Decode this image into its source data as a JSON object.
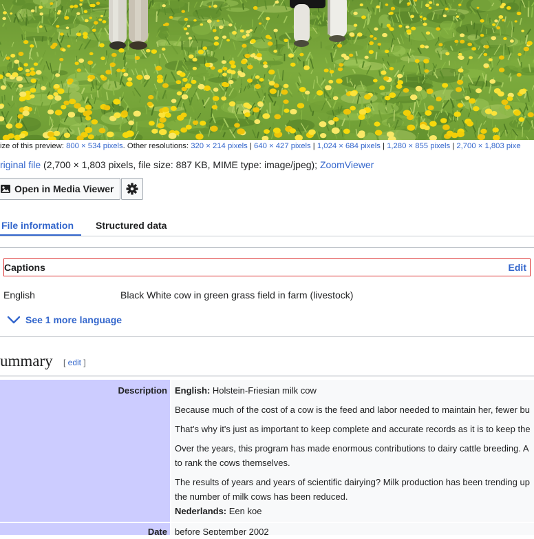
{
  "colors": {
    "link": "#3366cc",
    "text": "#202122",
    "label_bg": "#ccccff",
    "value_bg": "#f8f9fa",
    "caption_border": "#dd3333"
  },
  "resolution_info": {
    "prefix": "ize of this preview: ",
    "preview_size": "800 × 534 pixels",
    "other_label": ". Other resolutions: ",
    "separator": " | ",
    "resolutions": [
      "320 × 214 pixels",
      "640 × 427 pixels",
      "1,024 × 684 pixels",
      "1,280 × 855 pixels",
      "2,700 × 1,803 pixe"
    ]
  },
  "original_file": {
    "link_label": "riginal file",
    "details": " (2,700 × 1,803 pixels, file size: 887 KB, MIME type: image/jpeg); ",
    "zoom_label": "ZoomViewer"
  },
  "toolbar": {
    "media_viewer_label": "Open in Media Viewer",
    "media_viewer_icon": "image-icon",
    "settings_icon": "gear-icon"
  },
  "tabs": [
    {
      "label": "File information",
      "active": true
    },
    {
      "label": "Structured data",
      "active": false
    }
  ],
  "captions": {
    "title": "Captions",
    "edit_label": "Edit",
    "rows": [
      {
        "language": "English",
        "text": "Black White cow in green grass field in farm (livestock)"
      }
    ],
    "more_label": "See 1 more language",
    "more_icon": "chevron-down-icon"
  },
  "summary": {
    "heading": "ummary",
    "edit_open": "[ ",
    "edit_label": "edit",
    "edit_close": " ]",
    "description": {
      "label": "Description",
      "english_lang": "English:",
      "english_text": " Holstein-Friesian milk cow",
      "paragraphs": [
        [
          "Because much of the cost of a cow is the feed and labor needed to maintain her, fewer bu"
        ],
        [
          "That's why it's just as important to keep complete and accurate records as it is to keep the"
        ],
        [
          "Over the years, this program has made enormous contributions to dairy cattle breeding. A",
          "to rank the cows themselves."
        ],
        [
          "The results of years and years of scientific dairying? Milk production has been trending up",
          "the number of milk cows has been reduced."
        ]
      ],
      "nederlands_lang": "Nederlands:",
      "nederlands_text": " Een koe"
    },
    "date": {
      "label": "Date",
      "value": "before September 2002"
    }
  }
}
